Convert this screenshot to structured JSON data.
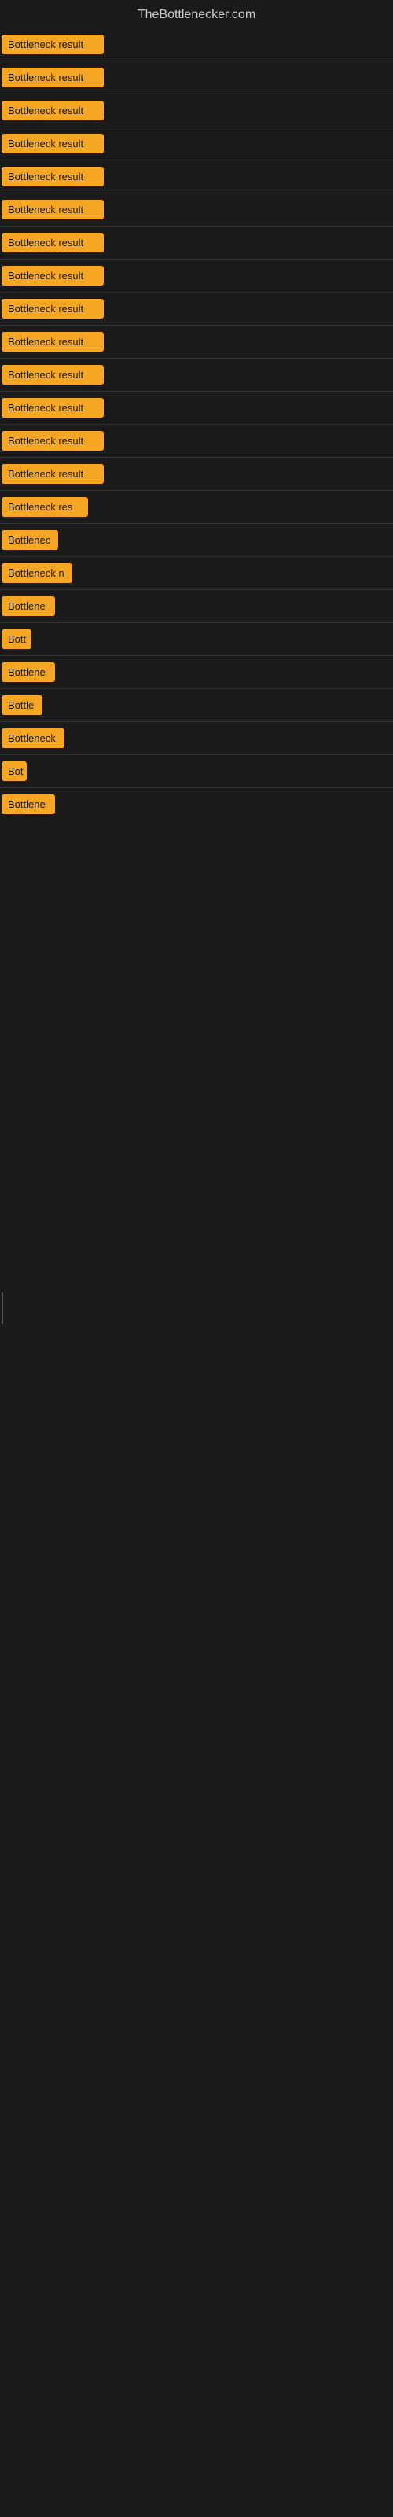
{
  "site": {
    "title": "TheBottlenecker.com"
  },
  "items": [
    {
      "id": 1,
      "label": "Bottleneck result",
      "width": "full"
    },
    {
      "id": 2,
      "label": "Bottleneck result",
      "width": "full"
    },
    {
      "id": 3,
      "label": "Bottleneck result",
      "width": "full"
    },
    {
      "id": 4,
      "label": "Bottleneck result",
      "width": "full"
    },
    {
      "id": 5,
      "label": "Bottleneck result",
      "width": "full"
    },
    {
      "id": 6,
      "label": "Bottleneck result",
      "width": "full"
    },
    {
      "id": 7,
      "label": "Bottleneck result",
      "width": "full"
    },
    {
      "id": 8,
      "label": "Bottleneck result",
      "width": "full"
    },
    {
      "id": 9,
      "label": "Bottleneck result",
      "width": "full"
    },
    {
      "id": 10,
      "label": "Bottleneck result",
      "width": "full"
    },
    {
      "id": 11,
      "label": "Bottleneck result",
      "width": "full"
    },
    {
      "id": 12,
      "label": "Bottleneck result",
      "width": "full"
    },
    {
      "id": 13,
      "label": "Bottleneck result",
      "width": "full"
    },
    {
      "id": 14,
      "label": "Bottleneck result",
      "width": "full"
    },
    {
      "id": 15,
      "label": "Bottleneck res",
      "width": "partial1"
    },
    {
      "id": 16,
      "label": "Bottlenec",
      "width": "partial2"
    },
    {
      "id": 17,
      "label": "Bottleneck n",
      "width": "partial3"
    },
    {
      "id": 18,
      "label": "Bottlene",
      "width": "partial4"
    },
    {
      "id": 19,
      "label": "Bott",
      "width": "partial5"
    },
    {
      "id": 20,
      "label": "Bottlene",
      "width": "partial4"
    },
    {
      "id": 21,
      "label": "Bottle",
      "width": "partial6"
    },
    {
      "id": 22,
      "label": "Bottleneck",
      "width": "partial7"
    },
    {
      "id": 23,
      "label": "Bot",
      "width": "partial8"
    },
    {
      "id": 24,
      "label": "Bottlene",
      "width": "partial4"
    }
  ]
}
